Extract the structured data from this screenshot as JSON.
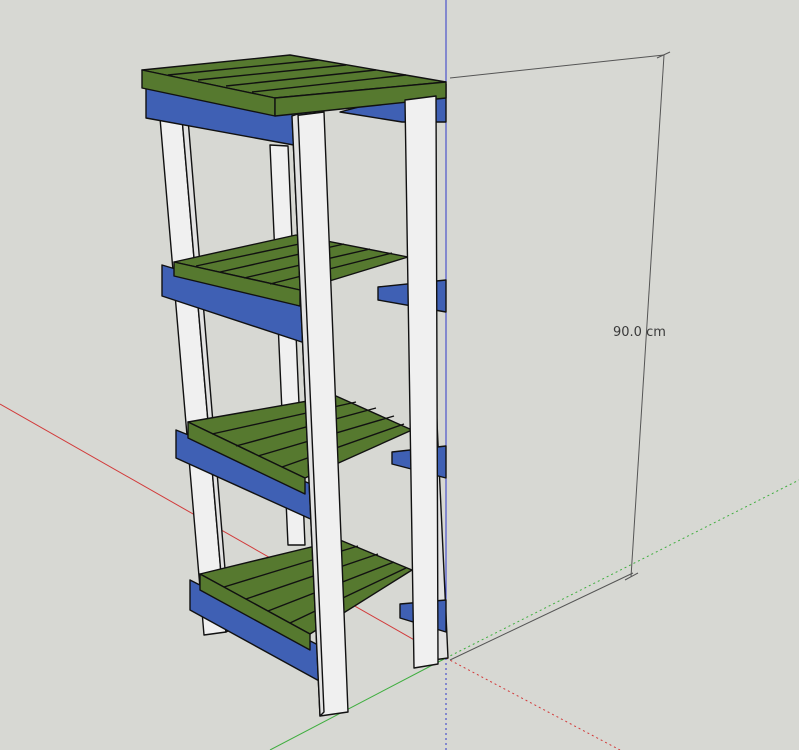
{
  "viewport": {
    "background": "#d7d8d3"
  },
  "model": {
    "name_visible": false,
    "colors": {
      "slat": "#56792f",
      "apron": "#3f60b4",
      "leg": "#f0f0f0",
      "edge": "#111111"
    }
  },
  "axes": {
    "red": "#d23a3a",
    "green": "#3fae3f",
    "blue": "#2f39c8"
  },
  "dimension": {
    "label": "90.0 cm"
  }
}
